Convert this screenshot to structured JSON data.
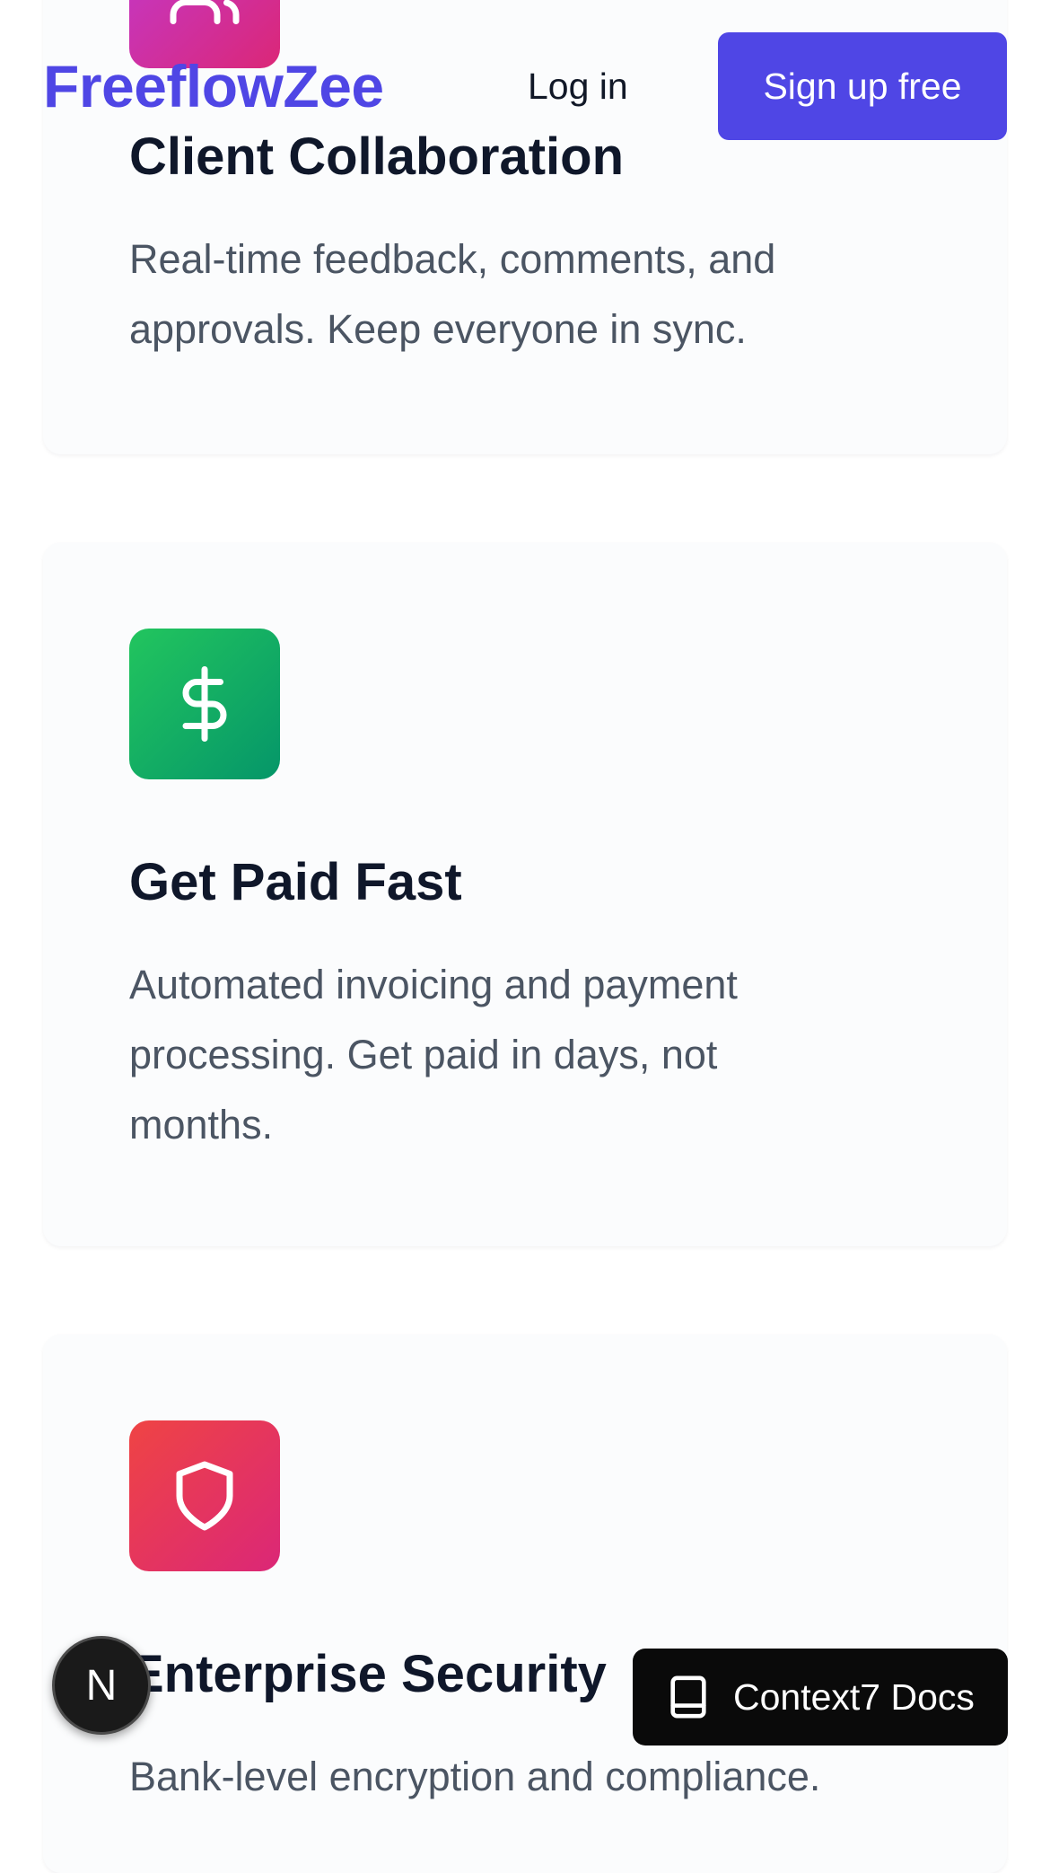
{
  "header": {
    "brand": "FreeflowZee",
    "login_label": "Log in",
    "signup_label": "Sign up free"
  },
  "features": [
    {
      "title": "Client Collaboration",
      "description": "Real-time feedback, comments, and approvals. Keep everyone in sync.",
      "icon": "users-icon",
      "icon_colors": [
        "#c03ad1",
        "#db2777"
      ]
    },
    {
      "title": "Get Paid Fast",
      "description": "Automated invoicing and payment processing. Get paid in days, not months.",
      "icon": "dollar-icon",
      "icon_colors": [
        "#22c55e",
        "#059669"
      ]
    },
    {
      "title": "Enterprise Security",
      "description": "Bank-level encryption and compliance.",
      "icon": "shield-icon",
      "icon_colors": [
        "#ef4444",
        "#db2777"
      ]
    }
  ],
  "floating": {
    "badge_letter": "N",
    "docs_label": "Context7 Docs",
    "docs_icon": "book-icon"
  },
  "colors": {
    "brand": "#4f46e5",
    "card_bg": "#fbfcfd",
    "text_dark": "#0f172a",
    "text_muted": "#4b5563"
  }
}
